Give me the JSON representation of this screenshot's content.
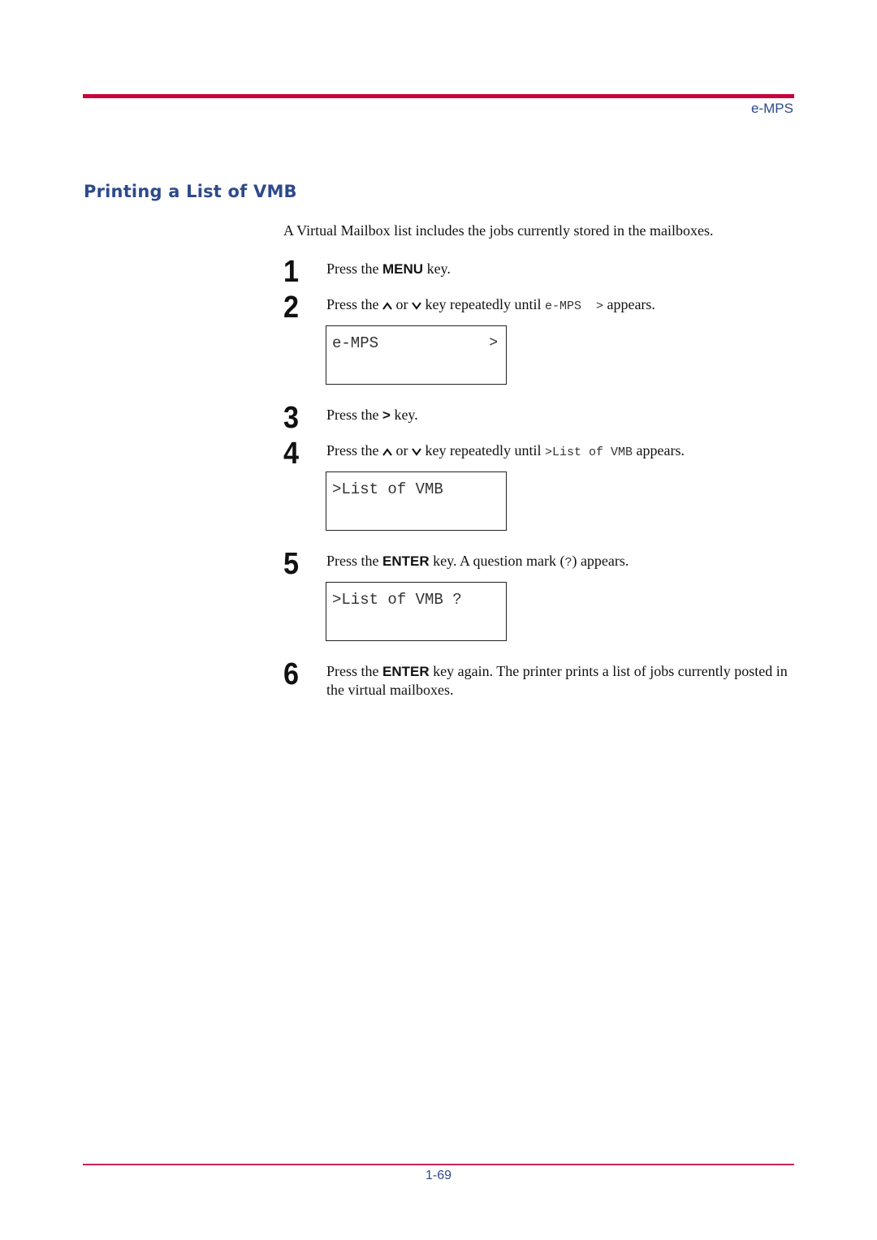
{
  "header": {
    "section_label": "e-MPS",
    "rule_color": "#c8003c"
  },
  "title": "Printing a List of VMB",
  "intro": "A Virtual Mailbox list includes the jobs currently stored in the mailboxes.",
  "steps": [
    {
      "number": "1",
      "pre": "Press the ",
      "key": "MENU",
      "post": " key."
    },
    {
      "number": "2",
      "pre": "Press the ",
      "or": " or ",
      "mid": " key repeatedly until ",
      "code": "e-MPS  >",
      "post": " appears."
    },
    {
      "number": "3",
      "pre": "Press the ",
      "key": ">",
      "post": " key."
    },
    {
      "number": "4",
      "pre": "Press the ",
      "or": " or ",
      "mid": " key repeatedly until ",
      "code": ">List of VMB",
      "post": " appears."
    },
    {
      "number": "5",
      "pre": "Press the ",
      "key": "ENTER",
      "post": " key. A question mark (",
      "code": "?",
      "post2": ") appears."
    },
    {
      "number": "6",
      "pre": "Press the ",
      "key": "ENTER",
      "post": " key again. The printer prints a list of jobs currently posted in the virtual mailboxes."
    }
  ],
  "displays": [
    {
      "text": "e-MPS",
      "right": ">"
    },
    {
      "text": ">List of VMB",
      "right": ""
    },
    {
      "text": ">List of VMB ?",
      "right": ""
    }
  ],
  "icons": {
    "up": "up-arrow-key-icon",
    "down": "down-arrow-key-icon"
  },
  "footer": {
    "page_number": "1-69"
  }
}
